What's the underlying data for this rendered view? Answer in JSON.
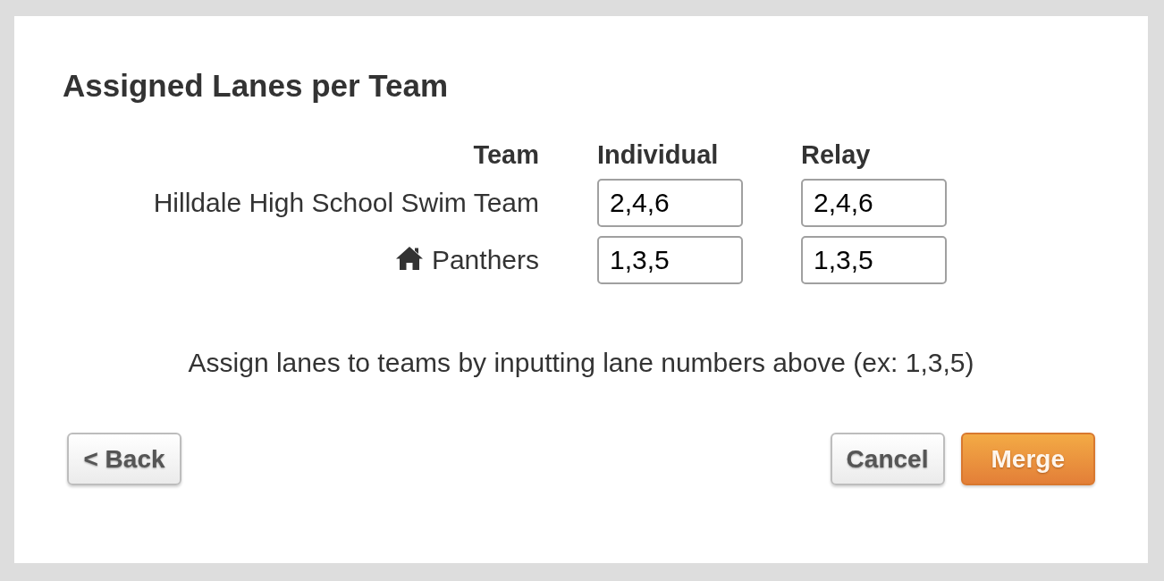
{
  "title": "Assigned Lanes per Team",
  "table": {
    "columns": [
      "Team",
      "Individual",
      "Relay"
    ],
    "rows": [
      {
        "team": "Hilldale High School Swim Team",
        "home": false,
        "individual": "2,4,6",
        "relay": "2,4,6"
      },
      {
        "team": "Panthers",
        "home": true,
        "individual": "1,3,5",
        "relay": "1,3,5"
      }
    ]
  },
  "hint": "Assign lanes to teams by inputting lane numbers above (ex: 1,3,5)",
  "footer": {
    "left_buttons": [
      {
        "label": "< Back",
        "kind": "secondary"
      }
    ],
    "right_buttons": [
      {
        "label": "Cancel",
        "kind": "secondary"
      },
      {
        "label": "Merge",
        "kind": "primary"
      }
    ]
  }
}
